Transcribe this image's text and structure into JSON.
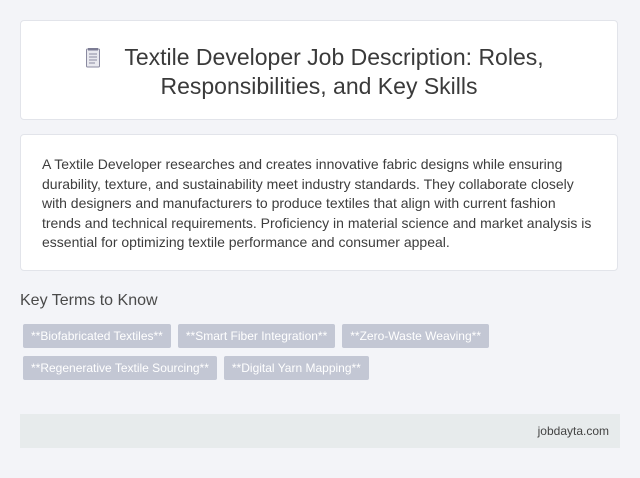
{
  "header": {
    "title_line1": "Textile Developer Job Description: Roles,",
    "title_line2": "Responsibilities, and Key Skills",
    "icon": "document-icon"
  },
  "description": {
    "text": "A Textile Developer researches and creates innovative fabric designs while ensuring durability, texture, and sustainability meet industry standards. They collaborate closely with designers and manufacturers to produce textiles that align with current fashion trends and technical requirements. Proficiency in material science and market analysis is essential for optimizing textile performance and consumer appeal."
  },
  "key_terms": {
    "heading": "Key Terms to Know",
    "items": [
      "**Biofabricated Textiles**",
      "**Smart Fiber Integration**",
      "**Zero-Waste Weaving**",
      "**Regenerative Textile Sourcing**",
      "**Digital Yarn Mapping**"
    ]
  },
  "footer": {
    "site": "jobdayta.com"
  },
  "colors": {
    "background": "#f3f4f8",
    "chip": "#c3c7d4",
    "footer": "#e7ebec"
  }
}
